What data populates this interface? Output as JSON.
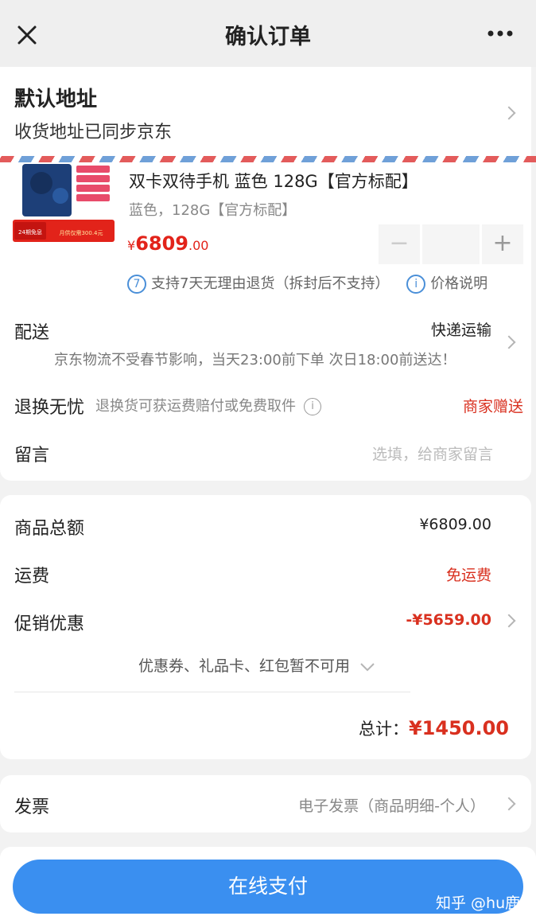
{
  "header": {
    "title": "确认订单",
    "close_icon": "close-icon",
    "more_icon": "more-icon"
  },
  "address": {
    "title": "默认地址",
    "subtitle": "收货地址已同步京东"
  },
  "product": {
    "title": "双卡双待手机 蓝色 128G【官方标配】",
    "spec": "蓝色，128G【官方标配】",
    "price_currency": "¥",
    "price_integer": "6809",
    "price_decimal": ".00",
    "quantity": "",
    "stepper_minus": "−",
    "stepper_plus": "+",
    "return_policy_badge": "7",
    "return_policy": "支持7天无理由退货（拆封后不支持）",
    "price_info_badge": "i",
    "price_info": "价格说明",
    "thumb_badge_top": "24期免息",
    "thumb_badge_bottom": "月供仅需300.4元"
  },
  "delivery": {
    "label": "配送",
    "method": "快递运输",
    "note": "京东物流不受春节影响，当天23:00前下单 次日18:00前送达！"
  },
  "returns": {
    "label": "退换无忧",
    "desc": "退换货可获运费赔付或免费取件",
    "info_badge": "i",
    "value": "商家赠送"
  },
  "message": {
    "label": "留言",
    "placeholder": "选填，给商家留言"
  },
  "fees": {
    "subtotal_label": "商品总额",
    "subtotal_value": "¥6809.00",
    "shipping_label": "运费",
    "shipping_value": "免运费",
    "promo_label": "促销优惠",
    "promo_value": "-¥5659.00",
    "coupon_note": "优惠券、礼品卡、红包暂不可用",
    "total_label": "总计：",
    "total_value": "¥1450.00"
  },
  "invoice": {
    "label": "发票",
    "value": "电子发票（商品明细-个人）"
  },
  "footer": {
    "pay_button": "在线支付",
    "watermark": "知乎 @hu鹿"
  },
  "colors": {
    "accent_blue": "#3a8ff0",
    "price_red": "#e2231a",
    "promo_red": "#d9301f"
  }
}
